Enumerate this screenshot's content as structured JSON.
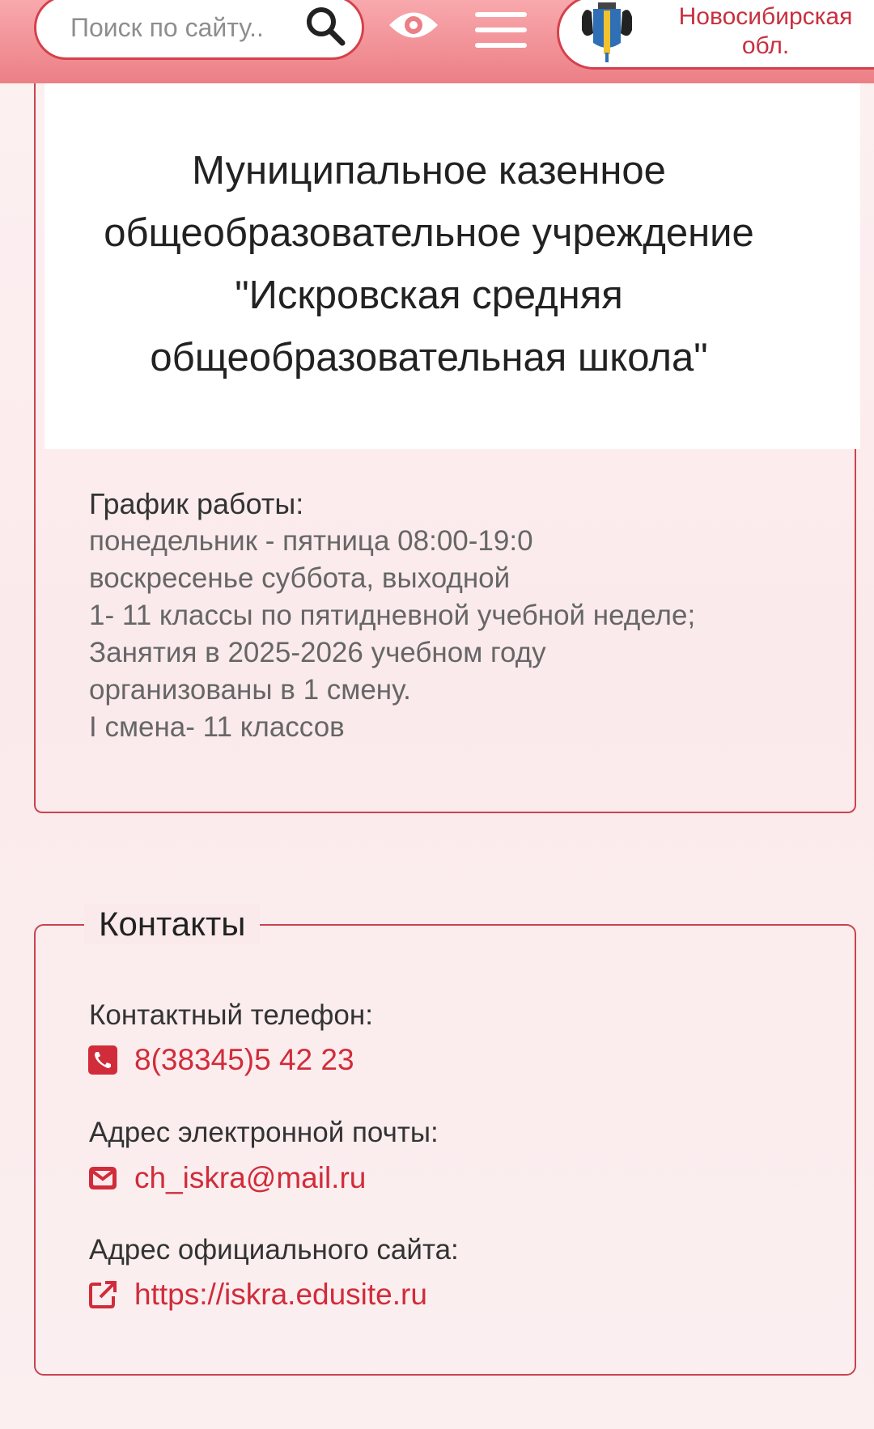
{
  "header": {
    "search": {
      "placeholder": "Поиск по сайту..",
      "value": ""
    },
    "region": {
      "line1": "Новосибирская",
      "line2": "обл."
    }
  },
  "title": {
    "line1": "Муниципальное казенное",
    "line2": "общеобразовательное учреждение",
    "line3": "\"Искровская средняя",
    "line4": "общеобразовательная школа\""
  },
  "schedule": {
    "label": "График работы:",
    "lines": [
      "понедельник - пятница 08:00-19:0",
      "воскресенье суббота, выходной",
      "1- 11 классы по пятидневной учебной неделе;",
      "Занятия в 2025-2026 учебном году",
      "организованы в 1 смену.",
      "I смена- 11 классов"
    ]
  },
  "contacts": {
    "title": "Контакты",
    "phone_label": "Контактный телефон:",
    "phone": "8(38345)5 42 23",
    "email_label": "Адрес электронной почты:",
    "email": "ch_iskra@mail.ru",
    "site_label": "Адрес официального сайта:",
    "site": "https://iskra.edusite.ru"
  },
  "icons": {
    "search": "search-icon",
    "accessibility": "eye-icon",
    "menu": "hamburger-menu-icon",
    "crest": "region-crest-icon",
    "phone": "phone-icon",
    "email": "envelope-icon",
    "site": "external-link-icon"
  },
  "colors": {
    "accent": "#d12c3a",
    "header": "#ec7f86",
    "border": "#c9444f"
  }
}
